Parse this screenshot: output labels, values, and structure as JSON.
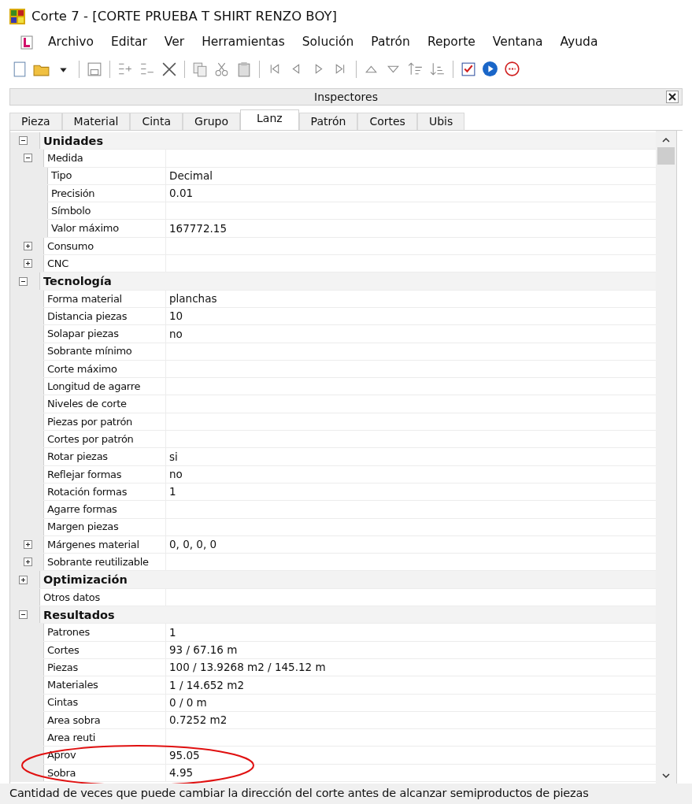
{
  "window": {
    "title": "Corte 7 - [CORTE PRUEBA T SHIRT RENZO BOY]"
  },
  "menu": [
    "Archivo",
    "Editar",
    "Ver",
    "Herramientas",
    "Solución",
    "Patrón",
    "Reporte",
    "Ventana",
    "Ayuda"
  ],
  "inspector": {
    "title": "Inspectores",
    "tabs": [
      {
        "label": "Pieza",
        "selected": false
      },
      {
        "label": "Material",
        "selected": false
      },
      {
        "label": "Cinta",
        "selected": false
      },
      {
        "label": "Grupo",
        "selected": false
      },
      {
        "label": "Lanz",
        "selected": true
      },
      {
        "label": "Patrón",
        "selected": false
      },
      {
        "label": "Cortes",
        "selected": false
      },
      {
        "label": "Ubis",
        "selected": false
      }
    ],
    "properties": [
      {
        "kind": "category",
        "label": "Unidades",
        "expanded": true,
        "children": [
          {
            "label": "Medida",
            "expanded": true,
            "children": [
              {
                "label": "Tipo",
                "value": "Decimal"
              },
              {
                "label": "Precisión",
                "value": "0.01"
              },
              {
                "label": "Símbolo"
              },
              {
                "label": "Valor máximo",
                "value": "167772.15"
              }
            ]
          },
          {
            "label": "Consumo",
            "expanded": false
          },
          {
            "label": "CNC",
            "expanded": false
          }
        ]
      },
      {
        "kind": "category",
        "label": "Tecnología",
        "expanded": true,
        "children": [
          {
            "label": "Forma material",
            "value": "planchas"
          },
          {
            "label": "Distancia piezas",
            "value": "10"
          },
          {
            "label": "Solapar piezas",
            "value": "no"
          },
          {
            "label": "Sobrante mínimo"
          },
          {
            "label": "Corte máximo"
          },
          {
            "label": "Longitud de agarre"
          },
          {
            "label": "Niveles de corte"
          },
          {
            "label": "Piezas por patrón"
          },
          {
            "label": "Cortes por patrón"
          },
          {
            "label": "Rotar piezas",
            "value": "si"
          },
          {
            "label": "Reflejar formas",
            "value": "no"
          },
          {
            "label": "Rotación formas",
            "value": "1"
          },
          {
            "label": "Agarre formas"
          },
          {
            "label": "Margen piezas"
          },
          {
            "label": "Márgenes material",
            "value": "0, 0, 0, 0",
            "expanded": false
          },
          {
            "label": "Sobrante reutilizable",
            "expanded": false
          }
        ]
      },
      {
        "kind": "category",
        "label": "Optimización",
        "expanded": false
      },
      {
        "kind": "property",
        "label": "Otros datos"
      },
      {
        "kind": "category",
        "label": "Resultados",
        "expanded": true,
        "children": [
          {
            "label": "Patrones",
            "value": "1"
          },
          {
            "label": "Cortes",
            "value": "93 / 67.16 m"
          },
          {
            "label": "Piezas",
            "value": "100 / 13.9268 m2 / 145.12 m"
          },
          {
            "label": "Materiales",
            "value": "1 / 14.652 m2"
          },
          {
            "label": "Cintas",
            "value": "0 / 0 m"
          },
          {
            "label": "Area sobra",
            "value": "0.7252 m2"
          },
          {
            "label": "Area reuti"
          },
          {
            "label": "Aprov",
            "value": "95.05"
          },
          {
            "label": "Sobra",
            "value": "4.95"
          }
        ]
      }
    ]
  },
  "status_bar": "Cantidad de veces que puede cambiar la dirección del corte antes de alcanzar semiproductos de piezas"
}
